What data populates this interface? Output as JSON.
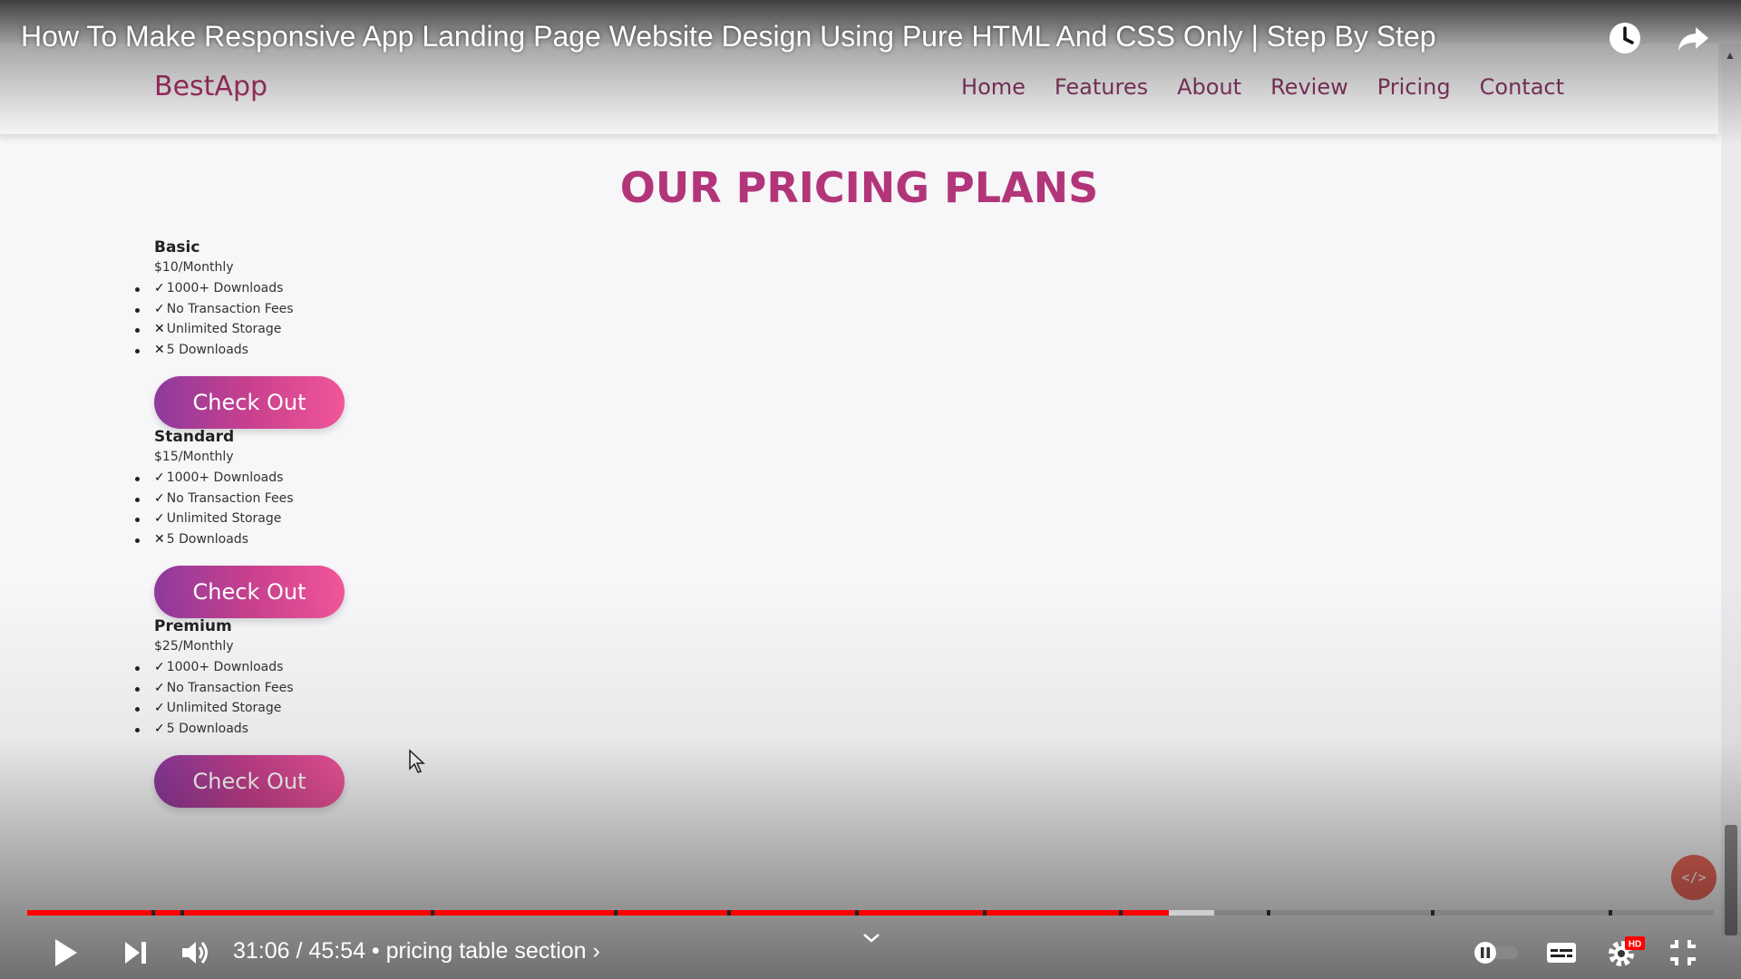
{
  "video": {
    "title": "How To Make Responsive App Landing Page Website Design Using Pure HTML And CSS Only | Step By Step",
    "current_time": "31:06",
    "duration": "45:54",
    "separator": " / ",
    "chapter": "• pricing table section ›",
    "progress_fraction": 0.677,
    "buffered_fraction": 0.704
  },
  "site": {
    "logo": "BestApp",
    "nav": [
      "Home",
      "Features",
      "About",
      "Review",
      "Pricing",
      "Contact"
    ],
    "section_title": "OUR PRICING PLANS",
    "plans": [
      {
        "name": "Basic",
        "price": "$10/Monthly",
        "features": [
          {
            "mark": "✓",
            "text": "1000+ Downloads"
          },
          {
            "mark": "✓",
            "text": "No Transaction Fees"
          },
          {
            "mark": "✕",
            "text": "Unlimited Storage"
          },
          {
            "mark": "✕",
            "text": "5 Downloads"
          }
        ],
        "button": "Check Out"
      },
      {
        "name": "Standard",
        "price": "$15/Monthly",
        "features": [
          {
            "mark": "✓",
            "text": "1000+ Downloads"
          },
          {
            "mark": "✓",
            "text": "No Transaction Fees"
          },
          {
            "mark": "✓",
            "text": "Unlimited Storage"
          },
          {
            "mark": "✕",
            "text": "5 Downloads"
          }
        ],
        "button": "Check Out"
      },
      {
        "name": "Premium",
        "price": "$25/Monthly",
        "features": [
          {
            "mark": "✓",
            "text": "1000+ Downloads"
          },
          {
            "mark": "✓",
            "text": "No Transaction Fees"
          },
          {
            "mark": "✓",
            "text": "Unlimited Storage"
          },
          {
            "mark": "✓",
            "text": "5 Downloads"
          }
        ],
        "button": "Check Out"
      }
    ],
    "code_badge": "</>"
  },
  "player_icons": {
    "watch_later": "clock-icon",
    "share": "share-icon",
    "play": "play-icon",
    "next": "next-icon",
    "volume": "volume-icon",
    "chapters": "chevron-down-icon",
    "autoplay": "autoplay-toggle-icon",
    "captions": "captions-icon",
    "settings": "gear-icon",
    "settings_badge": "HD",
    "exit_fullscreen": "exit-fullscreen-icon"
  },
  "colors": {
    "progress_played": "#ff0000",
    "progress_buffered": "#cfcfcf",
    "progress_rest": "#7a7a7a",
    "brand": "#b2357a"
  }
}
